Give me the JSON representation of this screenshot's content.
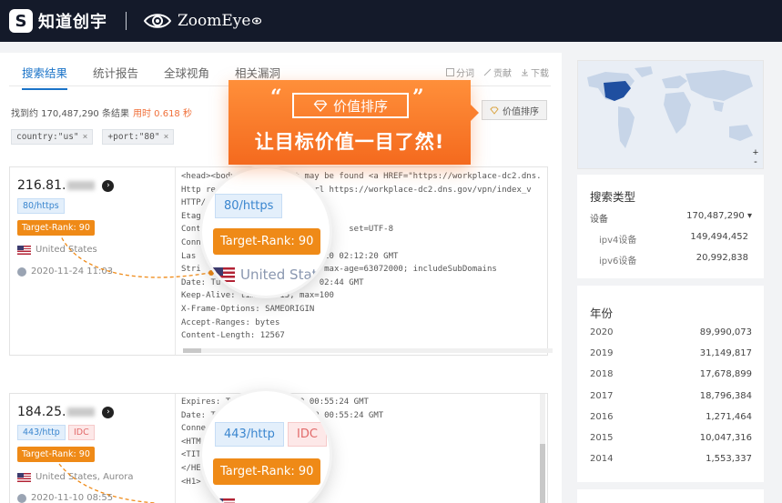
{
  "header": {
    "logo_glyph": "S",
    "brand_cn": "知道创宇",
    "product": "ZoomEye"
  },
  "tabs": [
    {
      "label": "搜索结果",
      "active": true
    },
    {
      "label": "统计报告",
      "active": false
    },
    {
      "label": "全球视角",
      "active": false
    },
    {
      "label": "相关漏洞",
      "active": false
    }
  ],
  "tools": {
    "share": "分词",
    "contribute": "贡献",
    "download": "下载"
  },
  "results": {
    "count_text": "找到约 170,487,290 条结果",
    "time_text": "用时 0.618 秒",
    "filters": [
      {
        "label": "country:\"us\"",
        "close": "×"
      },
      {
        "label": "+port:\"80\"",
        "close": "×"
      }
    ],
    "sort_label": "价值排序"
  },
  "card1": {
    "ip": "216.81.",
    "port": "80/https",
    "rank": "Target-Rank: 90",
    "country": "United States",
    "date": "2020-11-24 11:03",
    "code": [
      "<head><body> This object may be found <a HREF=\"https://workplace-dc2.dns.",
      "",
      "Http re                ed url https://workplace-dc2.dns.gov/vpn/index_v",
      "HTTP/",
      "Etag",
      "Cont                              set=UTF-8",
      "Conn",
      "Las                          20 02:12:20 GMT",
      "Stri                         max-age=63072000; includeSubDomains",
      "Date: Tu                    02:44 GMT",
      "Keep-Alive: timeout=15, max=100",
      "X-Frame-Options: SAMEORIGIN",
      "Accept-Ranges: bytes",
      "Content-Length: 12567"
    ],
    "mag_port": "80/https",
    "mag_rank": "Target-Rank: 90",
    "mag_country": "United States"
  },
  "card2": {
    "ip": "184.25.",
    "port": "443/http",
    "idc": "IDC",
    "rank": "Target-Rank: 90",
    "country": "United States, Aurora",
    "date": "2020-11-10 08:55",
    "code": [
      "Expires: Tue, 10 Nov 2020 00:55:24 GMT",
      "Date: Tue, 1            2020 00:55:24 GMT",
      "Connecti",
      "",
      "<HTM",
      "<TIT",
      "</HE",
      "<H1>"
    ],
    "mag_port": "443/http",
    "mag_idc": "IDC",
    "mag_rank": "Target-Rank: 90"
  },
  "promo": {
    "open_quote": "“",
    "close_quote": "”",
    "box_label": "价值排序",
    "headline": "让目标价值一目了然!"
  },
  "map": {
    "zoom_in": "+",
    "zoom_out": "-"
  },
  "search_type": {
    "title": "搜索类型",
    "device_label": "设备",
    "device_value": "170,487,290 ▾",
    "ipv4_label": "ipv4设备",
    "ipv4_value": "149,494,452",
    "ipv6_label": "ipv6设备",
    "ipv6_value": "20,992,838"
  },
  "years": {
    "title": "年份",
    "rows": [
      {
        "year": "2020",
        "value": "89,990,073"
      },
      {
        "year": "2019",
        "value": "31,149,817"
      },
      {
        "year": "2018",
        "value": "17,678,899"
      },
      {
        "year": "2017",
        "value": "18,796,384"
      },
      {
        "year": "2016",
        "value": "1,271,464"
      },
      {
        "year": "2015",
        "value": "10,047,316"
      },
      {
        "year": "2014",
        "value": "1,553,337"
      }
    ]
  },
  "colors": {
    "accent": "#1a73c8",
    "rank": "#ef8a17",
    "promo": "#f46a1e",
    "header": "#141a2a"
  }
}
